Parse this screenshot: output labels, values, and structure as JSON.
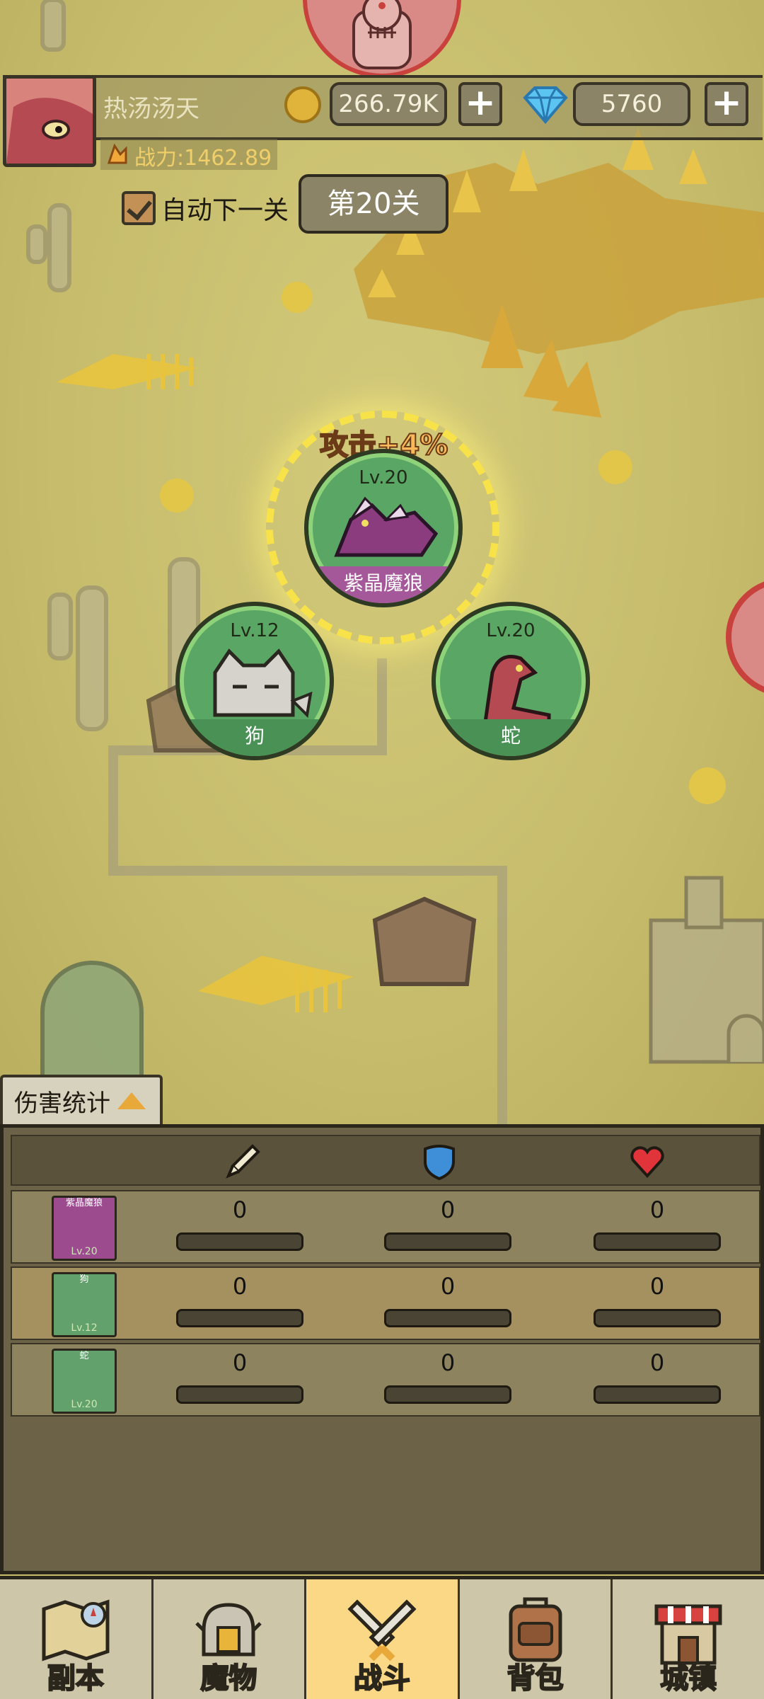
{
  "player": {
    "name": "热汤汤天",
    "power": "战力:1462.89",
    "gold": "266.79K",
    "gems": "5760",
    "add_gold": "+",
    "add_gems": "+"
  },
  "stage": {
    "auto_next_label": "自动下一关",
    "auto_next_checked": true,
    "stage_label": "第20关"
  },
  "buff": "攻击+4%",
  "monsters": [
    {
      "name": "紫晶魔狼",
      "level": "Lv.20",
      "color": "#a45799"
    },
    {
      "name": "狗",
      "level": "Lv.12",
      "color": "#4a9156"
    },
    {
      "name": "蛇",
      "level": "Lv.20",
      "color": "#4a9156"
    }
  ],
  "damage_stats": {
    "tab_label": "伤害统计",
    "columns": [
      "attack-icon",
      "shield-icon",
      "heart-icon"
    ],
    "rows": [
      {
        "name": "紫晶魔狼",
        "level": "Lv.20",
        "attack": "0",
        "defense": "0",
        "heal": "0"
      },
      {
        "name": "狗",
        "level": "Lv.12",
        "attack": "0",
        "defense": "0",
        "heal": "0"
      },
      {
        "name": "蛇",
        "level": "Lv.20",
        "attack": "0",
        "defense": "0",
        "heal": "0"
      }
    ]
  },
  "nav": [
    {
      "label": "副本",
      "icon": "map-icon",
      "active": false
    },
    {
      "label": "魔物",
      "icon": "helmet-icon",
      "active": false
    },
    {
      "label": "战斗",
      "icon": "crossed-swords-icon",
      "active": true
    },
    {
      "label": "背包",
      "icon": "backpack-icon",
      "active": false
    },
    {
      "label": "城镇",
      "icon": "shop-icon",
      "active": false
    }
  ],
  "colors": {
    "panel": "#6c6248",
    "nav_active": "#fbd886",
    "monster_green": "#5aa665",
    "boss_ring": "#c9413d"
  }
}
